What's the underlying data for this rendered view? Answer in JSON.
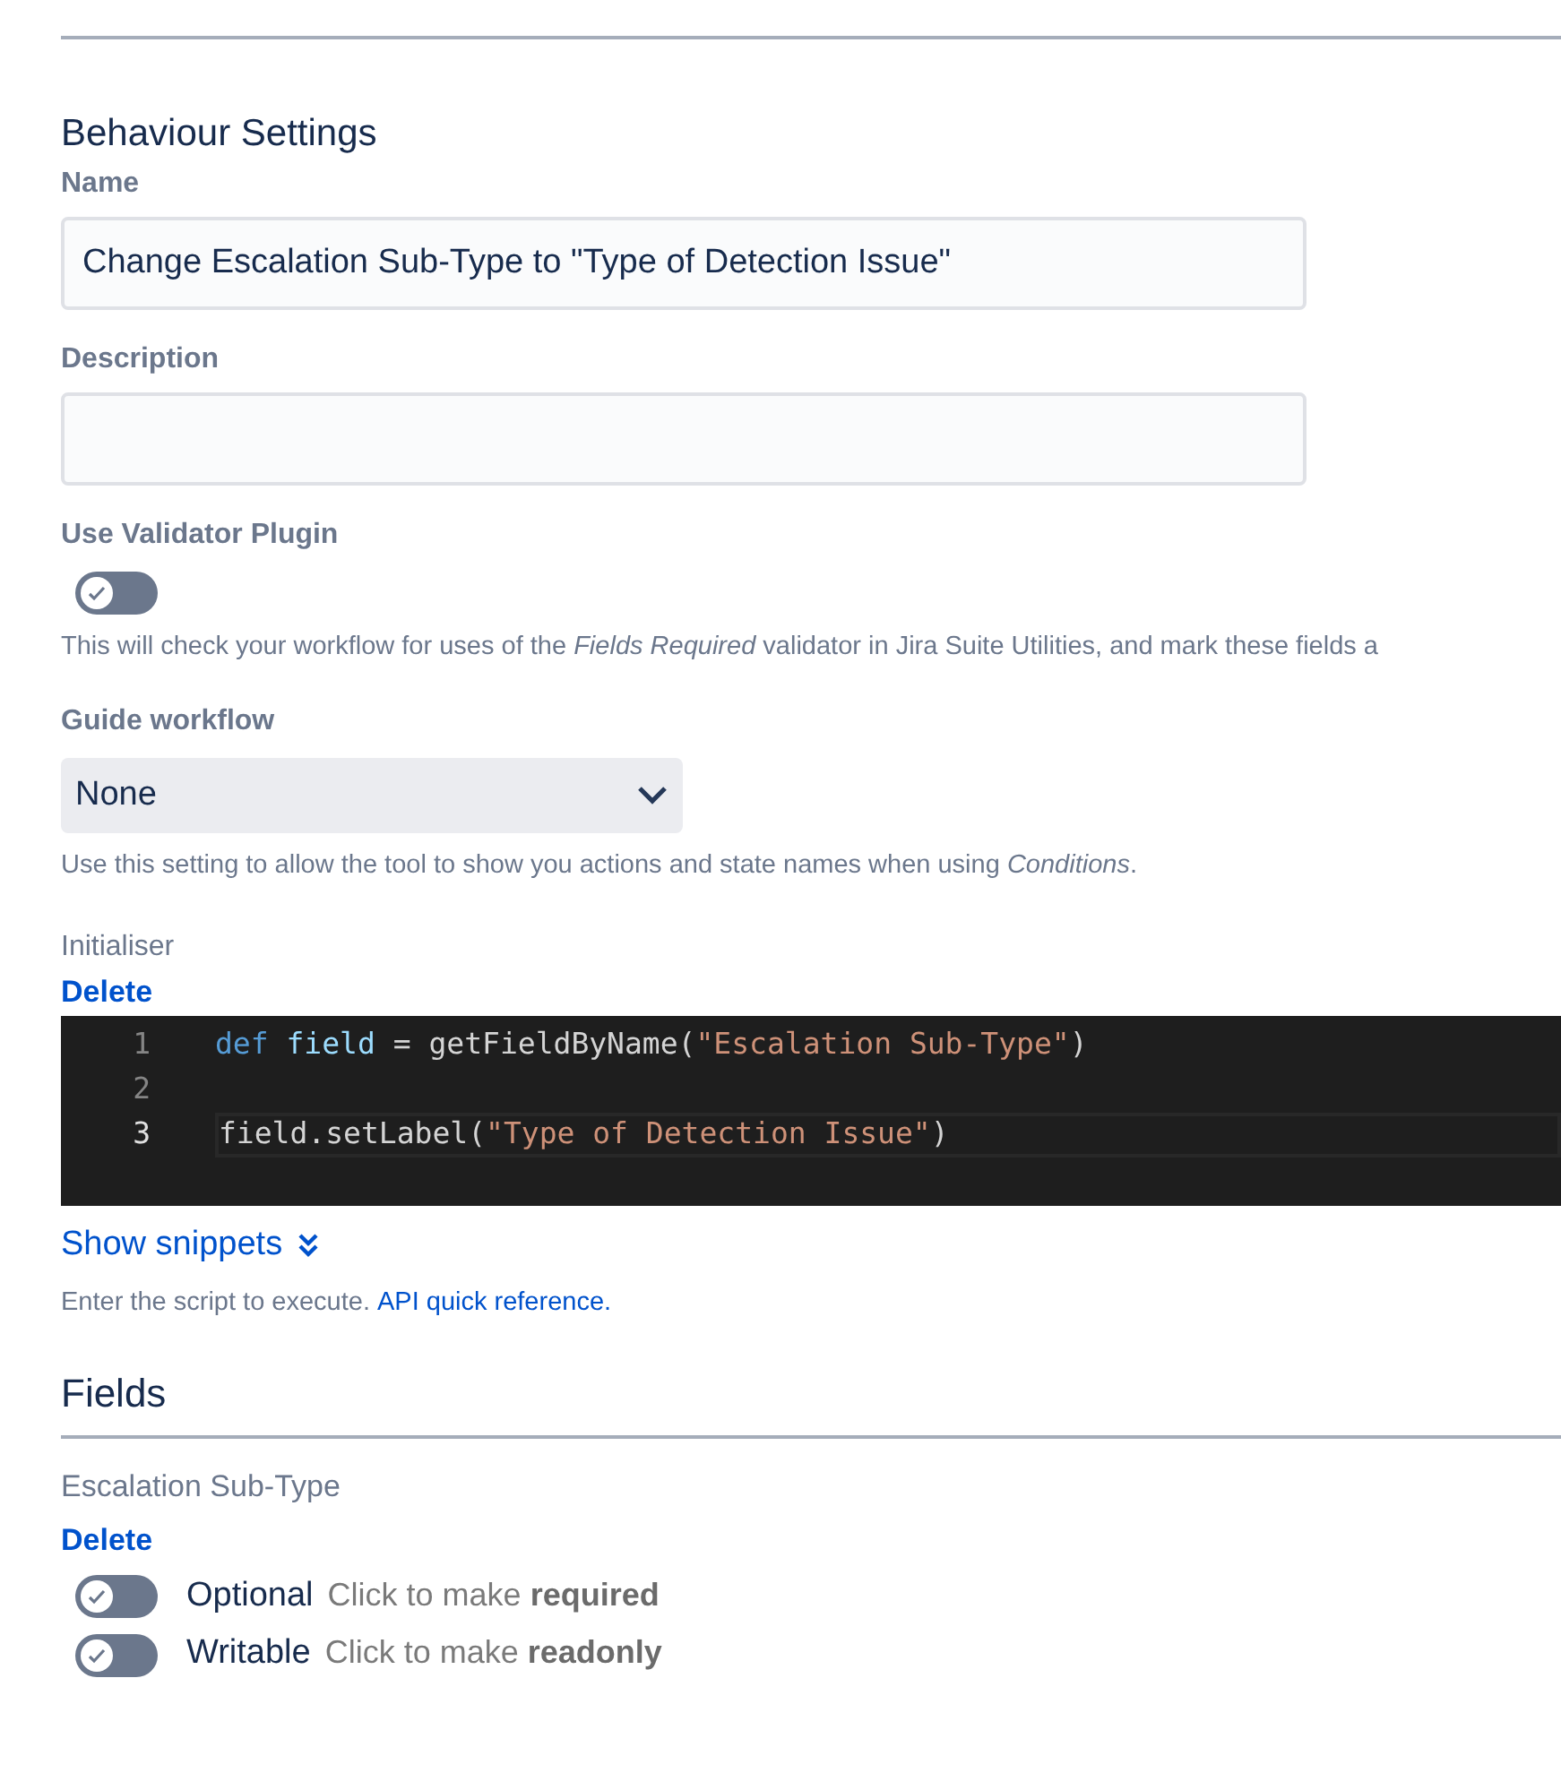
{
  "heading": "Behaviour Settings",
  "name_field": {
    "label": "Name",
    "value": "Change Escalation Sub-Type to \"Type of Detection Issue\""
  },
  "description_field": {
    "label": "Description"
  },
  "validator": {
    "label": "Use Validator Plugin",
    "on": false,
    "help": "This will check your workflow for uses of the *Fields Required* validator in Jira Suite Utilities, and mark these fields a"
  },
  "guide_workflow": {
    "label": "Guide workflow",
    "value": "None",
    "help": "Use this setting to allow the tool to show you actions and state names when using *Conditions*."
  },
  "initialiser": {
    "label": "Initialiser",
    "delete": "Delete",
    "code_lines": [
      {
        "number": "1",
        "active": false,
        "tokens": [
          {
            "kind": "keyword",
            "text": "def "
          },
          {
            "kind": "variable",
            "text": "field"
          },
          {
            "kind": "plain",
            "text": " = getFieldByName("
          },
          {
            "kind": "string",
            "text": "\"Escalation Sub-Type\""
          },
          {
            "kind": "plain",
            "text": ")"
          }
        ]
      },
      {
        "number": "2",
        "active": false
      },
      {
        "number": "3",
        "active": true,
        "tokens": [
          {
            "kind": "plain",
            "text": "field.setLabel("
          },
          {
            "kind": "string",
            "text": "\"Type of Detection Issue\""
          },
          {
            "kind": "plain",
            "text": ")"
          }
        ]
      }
    ],
    "snippets": "Show snippets",
    "help": "Enter the script to execute.",
    "help_link": "API quick reference."
  },
  "fields": {
    "heading": "Fields",
    "items": [
      {
        "name": "Escalation Sub-Type",
        "delete": "Delete",
        "toggles": [
          {
            "on": false,
            "state": "Optional",
            "action": "Click to make **required**"
          },
          {
            "on": false,
            "state": "Writable",
            "action": "Click to make **readonly**"
          }
        ]
      }
    ]
  }
}
